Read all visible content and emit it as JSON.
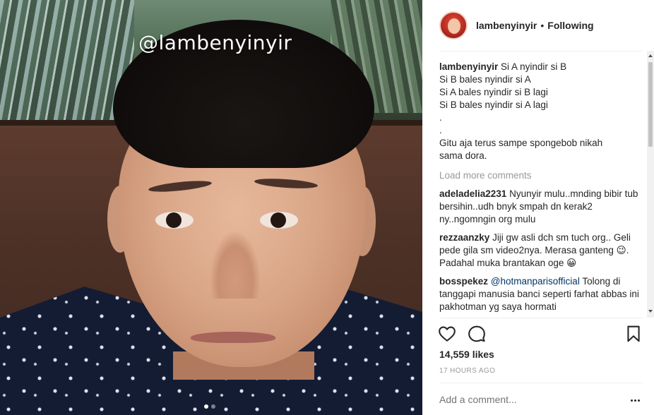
{
  "media": {
    "watermark": "@lambenyinyir",
    "carousel_dots": 2,
    "carousel_active": 1
  },
  "post": {
    "username": "lambenyinyir",
    "separator": "•",
    "follow_status": "Following",
    "caption_user": "lambenyinyir",
    "caption_lines": [
      "Si A nyindir si B",
      "Si B bales nyindir si A",
      "Si A bales nyindir si B lagi",
      "Si B bales nyindir si A lagi",
      ".",
      ".",
      "Gitu aja terus sampe spongebob nikah",
      "sama dora."
    ],
    "load_more": "Load more comments",
    "comments": [
      {
        "user": "adeladelia2231",
        "text": "Nyunyir mulu..mnding bibir tub bersihin..udh bnyk smpah dn kerak2 ny..ngomngin org mulu"
      },
      {
        "user": "rezzaanzky",
        "text": "Jiji gw asli dch sm tuch org.. Geli pede gila sm video2nya. Merasa ganteng 😉. Padahal muka brantakan oge 😀"
      },
      {
        "user": "bosspekez",
        "mention": "@hotmanparisofficial",
        "text": "Tolong di tanggapi manusia banci seperti farhat abbas ini pakhotman yg saya hormati"
      }
    ],
    "likes": "14,559 likes",
    "time": "17 HOURS AGO",
    "add_comment_placeholder": "Add a comment..."
  },
  "icons": {
    "heart": "heart-icon",
    "comment": "comment-icon",
    "bookmark": "bookmark-icon",
    "more": "more-options-icon"
  }
}
